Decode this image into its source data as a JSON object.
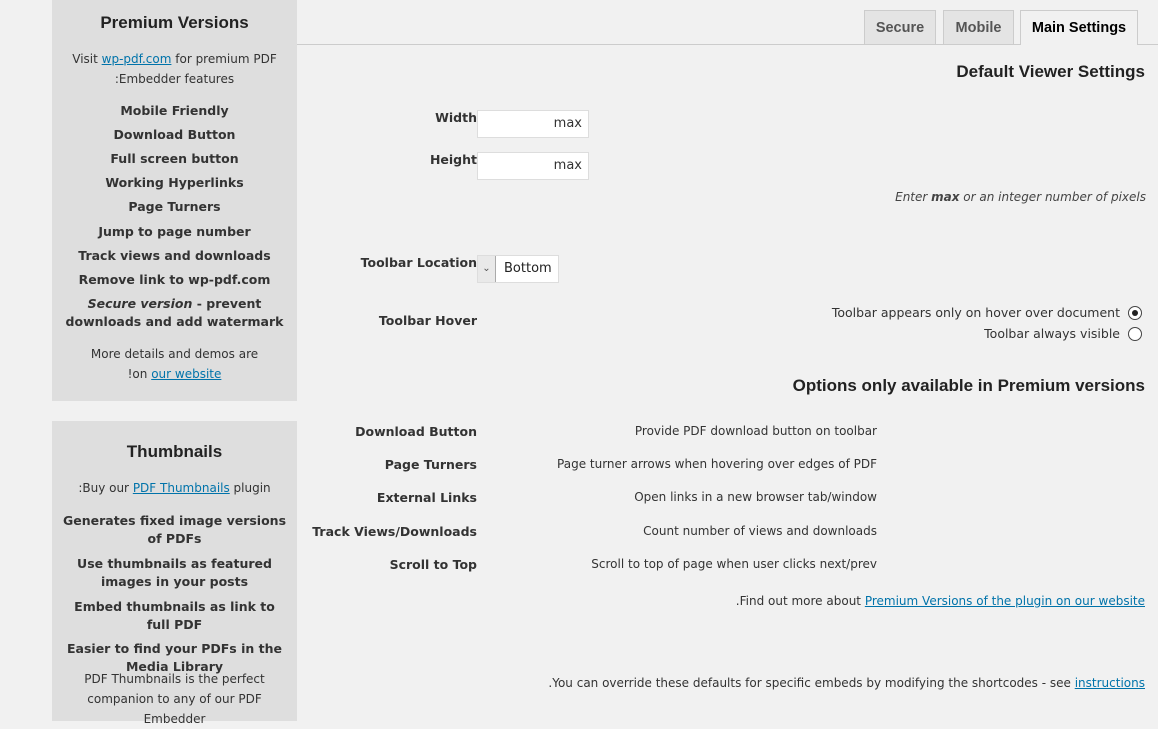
{
  "sidebar": {
    "premium": {
      "title": "Premium Versions",
      "intro_prefix": "Visit ",
      "intro_link": "wp-pdf.com",
      "intro_suffix": " for premium PDF",
      "intro_line2": ":Embedder features",
      "features": [
        "Mobile Friendly",
        "Download Button",
        "Full screen button",
        "Working Hyperlinks",
        "Page Turners",
        "Jump to page number",
        "Track views and downloads",
        "Remove link to wp-pdf.com"
      ],
      "secure_em": "Secure version",
      "secure_rest": " - prevent",
      "secure_line2": "downloads and add watermark",
      "outro_line1": "More details and demos are",
      "outro_prefix": "!on ",
      "outro_link": "our website"
    },
    "thumbnails": {
      "title": "Thumbnails",
      "intro_prefix": ":Buy our ",
      "intro_link": "PDF Thumbnails",
      "intro_suffix": " plugin",
      "features": [
        "Generates fixed image versions of PDFs",
        "Use thumbnails as featured images in your posts",
        "Embed thumbnails as link to full PDF",
        "Easier to find your PDFs in the Media Library"
      ],
      "outro_line1": "PDF Thumbnails is the perfect",
      "outro_line2": "companion to any of our PDF Embedder"
    }
  },
  "tabs": [
    "Secure",
    "Mobile",
    "Main Settings"
  ],
  "active_tab": "Main Settings",
  "main": {
    "default_title": "Default Viewer Settings",
    "width_label": "Width",
    "width_value": "max",
    "height_label": "Height",
    "height_value": "max",
    "hint_prefix": "Enter ",
    "hint_bold": "max",
    "hint_suffix": " or an integer number of pixels",
    "toolbar_location_label": "Toolbar Location",
    "toolbar_location_value": "Bottom",
    "toolbar_hover_label": "Toolbar Hover",
    "hover_options": [
      {
        "label": "Toolbar appears only on hover over document",
        "checked": true
      },
      {
        "label": "Toolbar always visible",
        "checked": false
      }
    ],
    "premium_title": "Options only available in Premium versions",
    "premium_options": [
      {
        "label": "Download Button",
        "desc": "Provide PDF download button on toolbar"
      },
      {
        "label": "Page Turners",
        "desc": "Page turner arrows when hovering over edges of PDF"
      },
      {
        "label": "External Links",
        "desc": "Open links in a new browser tab/window"
      },
      {
        "label": "Track Views/Downloads",
        "desc": "Count number of views and downloads"
      },
      {
        "label": "Scroll to Top",
        "desc": "Scroll to top of page when user clicks next/prev"
      }
    ],
    "findout_prefix": ".Find out more about ",
    "findout_link": "Premium Versions of the plugin on our website",
    "override_prefix": ".You can override these defaults for specific embeds by modifying the shortcodes - see ",
    "override_link": "instructions"
  }
}
